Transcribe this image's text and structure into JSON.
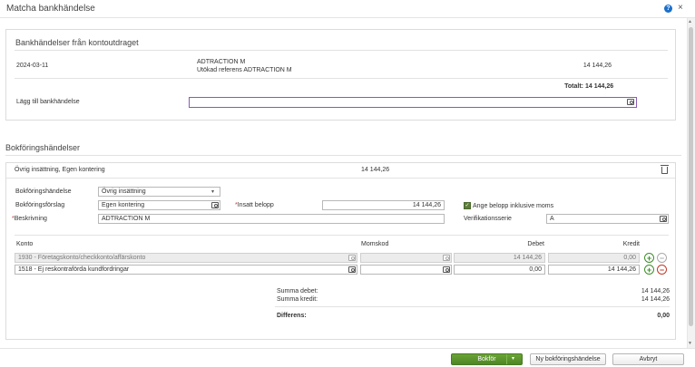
{
  "window": {
    "title": "Matcha bankhändelse",
    "help_label": "?",
    "close_label": "×"
  },
  "bank_section": {
    "title": "Bankhändelser från kontoutdraget",
    "row": {
      "date": "2024-03-11",
      "name": "ADTRACTION M",
      "reference": "Utökad referens ADTRACTION M",
      "amount": "14 144,26"
    },
    "total_label": "Totalt:",
    "total_value": "14 144,26",
    "add_label": "Lägg till bankhändelse",
    "add_value": ""
  },
  "booking_section": {
    "title": "Bokföringshändelser",
    "event_header": {
      "label": "Övrig insättning, Egen kontering",
      "amount": "14 144,26"
    },
    "fields": {
      "event_label": "Bokföringshändelse",
      "event_value": "Övrig insättning",
      "proposal_label": "Bokföringsförslag",
      "proposal_value": "Egen kontering",
      "deposit_label": "Insatt belopp",
      "deposit_value": "14 144,26",
      "incl_vat_label": "Ange belopp inklusive moms",
      "description_label": "Beskrivning",
      "description_value": "ADTRACTION M",
      "series_label": "Verifikationsserie",
      "series_value": "A"
    },
    "table": {
      "headers": {
        "account": "Konto",
        "vat": "Momskod",
        "debit": "Debet",
        "credit": "Kredit"
      },
      "rows": [
        {
          "account": "1930 - Företagskonto/checkkonto/affärskonto",
          "vat": "",
          "debit": "14 144,26",
          "credit": "0,00"
        },
        {
          "account": "1518 - Ej reskontraförda kundfordringar",
          "vat": "",
          "debit": "0,00",
          "credit": "14 144,26"
        }
      ]
    },
    "sums": {
      "debit_label": "Summa debet:",
      "debit_value": "14 144,26",
      "credit_label": "Summa kredit:",
      "credit_value": "14 144,26",
      "diff_label": "Differens:",
      "diff_value": "0,00"
    }
  },
  "footer": {
    "post_label": "Bokför",
    "new_event_label": "Ny bokföringshändelse",
    "cancel_label": "Avbryt"
  },
  "icons": {
    "add": "plus-icon",
    "remove": "minus-icon",
    "lookup": "search-list-icon",
    "delete": "trash-icon",
    "dropdown": "chevron-down-icon"
  },
  "colors": {
    "primary_button": "#5a9530",
    "help": "#1a6fc9",
    "required": "#c0392b",
    "focus": "#8a5ab8"
  }
}
